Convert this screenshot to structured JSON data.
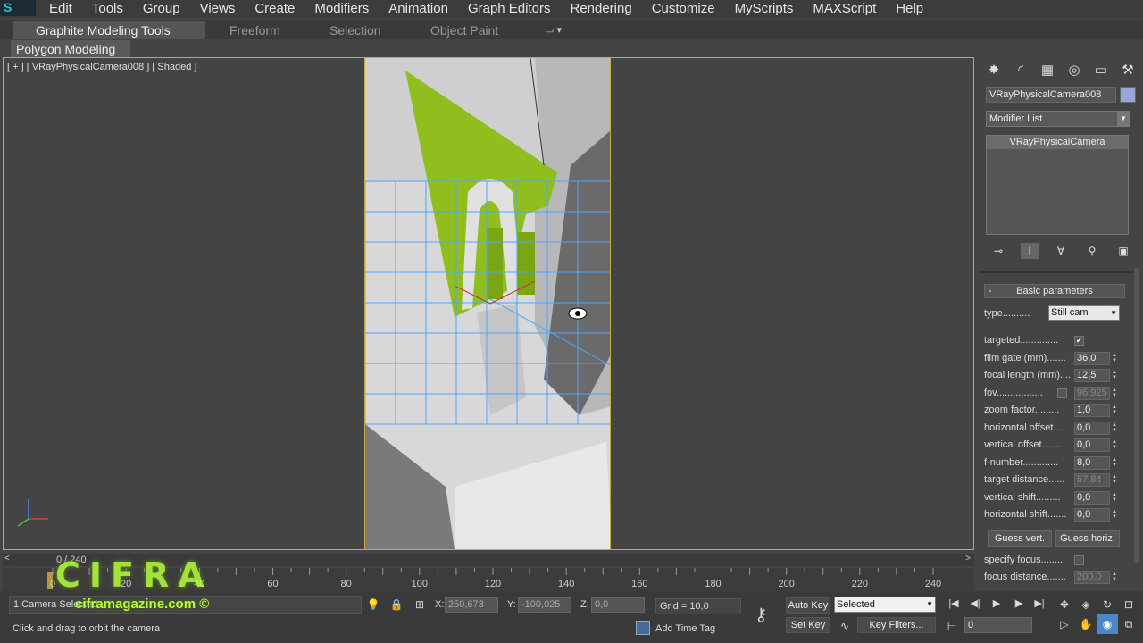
{
  "app": {
    "logo": "S"
  },
  "menu": [
    "Edit",
    "Tools",
    "Group",
    "Views",
    "Create",
    "Modifiers",
    "Animation",
    "Graph Editors",
    "Rendering",
    "Customize",
    "MyScripts",
    "MAXScript",
    "Help"
  ],
  "ribbon": {
    "tabs": {
      "graphite": "Graphite Modeling Tools",
      "freeform": "Freeform",
      "selection": "Selection",
      "object_paint": "Object Paint",
      "dropdown": "▭ ▾"
    },
    "panel": "Polygon Modeling"
  },
  "viewport": {
    "label": "[ + ] [ VRayPhysicalCamera008 ] [ Shaded ]"
  },
  "command_panel": {
    "tab_icons": [
      "create-icon",
      "modify-icon",
      "hierarchy-icon",
      "motion-icon",
      "display-icon",
      "utilities-icon"
    ],
    "tab_glyphs": [
      "✸",
      "◜",
      "▦",
      "◎",
      "▭",
      "⚒"
    ],
    "object_name": "VRayPhysicalCamera008",
    "object_color": "#9aa6d8",
    "modifier_list": "Modifier List",
    "stack_item": "VRayPhysicalCamera",
    "rollout_title": "Basic parameters",
    "type_label": "type..........",
    "type_value": "Still cam",
    "params": [
      {
        "label": "targeted..............",
        "kind": "check",
        "checked": "✔"
      },
      {
        "label": "film gate (mm).......",
        "value": "36,0"
      },
      {
        "label": "focal length (mm)....",
        "value": "12,5"
      },
      {
        "label": "fov.................",
        "value": "96,925",
        "dim": true,
        "check": ""
      },
      {
        "label": "zoom factor.........",
        "value": "1,0"
      },
      {
        "label": "horizontal offset....",
        "value": "0,0"
      },
      {
        "label": "vertical offset.......",
        "value": "0,0"
      },
      {
        "label": "f-number.............",
        "value": "8,0"
      },
      {
        "label": "target distance......",
        "value": "57,84",
        "dim": true
      },
      {
        "label": "vertical shift.........",
        "value": "0,0"
      },
      {
        "label": "horizontal shift.......",
        "value": "0,0"
      }
    ],
    "guess_vert": "Guess vert.",
    "guess_horiz": "Guess horiz.",
    "specify_focus": "specify focus.........",
    "focus_distance_label": "focus distance.......",
    "focus_distance": "200,0"
  },
  "timeline": {
    "frame_label": "0 / 240",
    "ticks": [
      0,
      20,
      40,
      60,
      80,
      100,
      120,
      140,
      160,
      180,
      200,
      220,
      240
    ],
    "range_max": 240
  },
  "watermark": {
    "logo": "CIFRA",
    "url": "ciframagazine.com ©"
  },
  "status": {
    "selection": "1 Camera Selected",
    "prompt": "Click and drag to orbit the camera",
    "x_label": "X:",
    "x": "250,673",
    "y_label": "Y:",
    "y": "-100,025",
    "z_label": "Z:",
    "z": "0,0",
    "grid": "Grid = 10,0",
    "add_time_tag": "Add Time Tag",
    "auto_key": "Auto Key",
    "set_key": "Set Key",
    "selected": "Selected",
    "key_filters": "Key Filters...",
    "frame": "0"
  }
}
